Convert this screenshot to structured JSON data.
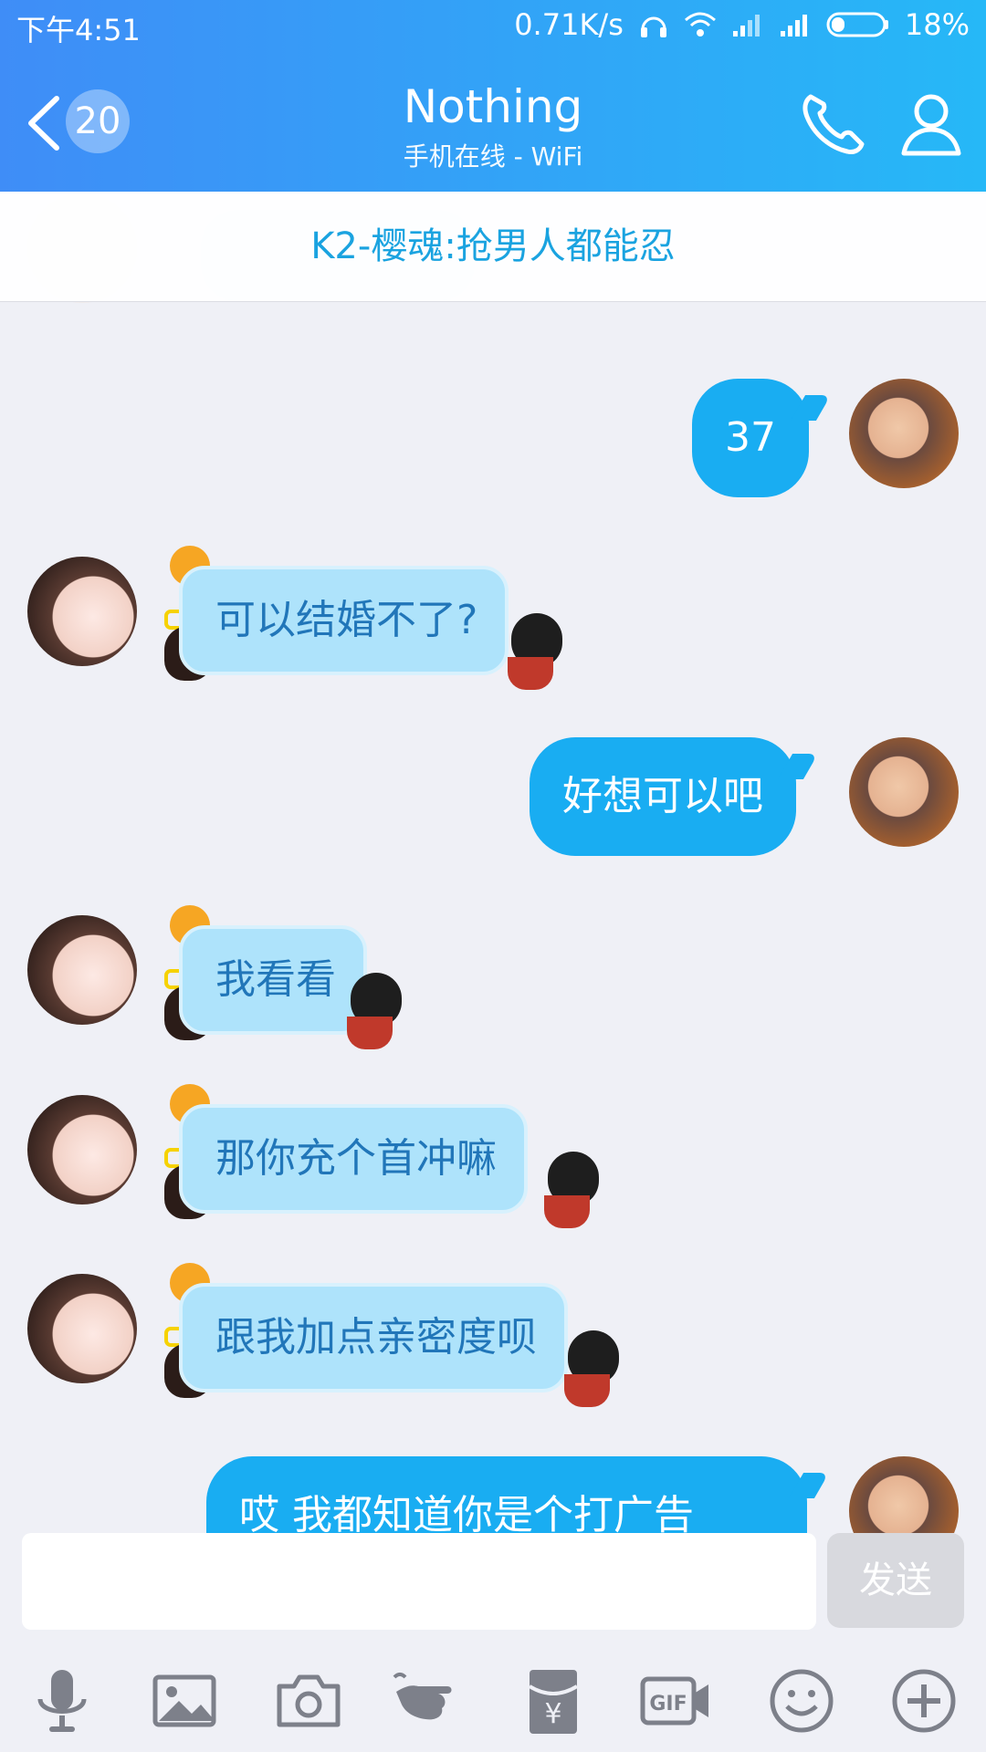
{
  "status": {
    "time": "下午4:51",
    "speed": "0.71K/s",
    "battery": "18%"
  },
  "header": {
    "badge": "20",
    "title": "Nothing",
    "subtitle": "手机在线 - WiFi"
  },
  "banner": {
    "text": "K2-樱魂:抢男人都能忍"
  },
  "messages": [
    {
      "from": "me",
      "text": "37"
    },
    {
      "from": "her",
      "text": "可以结婚不了?"
    },
    {
      "from": "me",
      "text": "好想可以吧"
    },
    {
      "from": "her",
      "text": "我看看"
    },
    {
      "from": "her",
      "text": "那你充个首冲嘛"
    },
    {
      "from": "her",
      "text": "跟我加点亲密度呗"
    },
    {
      "from": "me",
      "text": "哎 我都知道你是个打广告"
    }
  ],
  "input": {
    "placeholder": "",
    "send_label": "发送"
  },
  "toolbar": [
    "microphone-icon",
    "image-icon",
    "camera-icon",
    "poke-icon",
    "red-packet-icon",
    "gif-icon",
    "emoji-icon",
    "plus-icon"
  ],
  "colors": {
    "header_start": "#3f8df7",
    "header_end": "#26b8f7",
    "my_bubble": "#19adf2",
    "her_bubble": "#aee3fb",
    "background": "#eff0f6"
  }
}
